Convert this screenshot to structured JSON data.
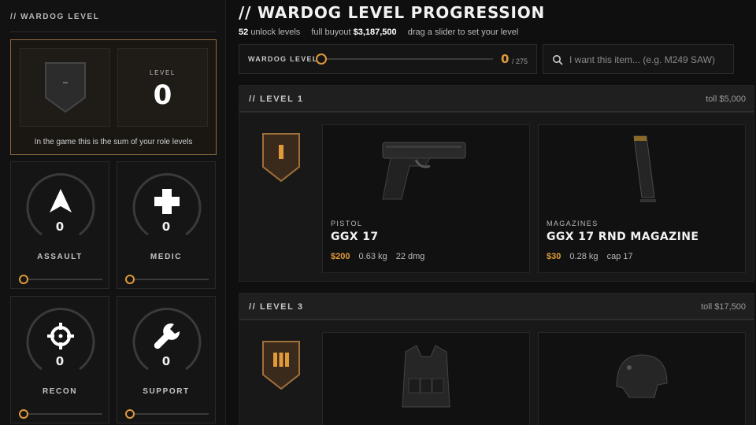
{
  "sidebar": {
    "title": "// WARDOG LEVEL",
    "level_caption": "LEVEL",
    "level_value": "0",
    "level_note": "In the game this is the sum of your role levels",
    "roles": [
      {
        "name": "ASSAULT",
        "value": "0",
        "icon": "assault-arrow-icon"
      },
      {
        "name": "MEDIC",
        "value": "0",
        "icon": "medic-cross-icon"
      },
      {
        "name": "RECON",
        "value": "0",
        "icon": "recon-crosshair-icon"
      },
      {
        "name": "SUPPORT",
        "value": "0",
        "icon": "support-wrench-icon"
      }
    ]
  },
  "header": {
    "title": "// WARDOG LEVEL PROGRESSION",
    "unlock_count": "52",
    "unlock_label": "unlock levels",
    "buyout_label": "full buyout",
    "buyout_value": "$3,187,500",
    "hint": "drag a slider to set your level"
  },
  "wardog_slider": {
    "label": "WARDOG LEVEL",
    "value": "0",
    "max": "/ 275",
    "fraction": 0
  },
  "search": {
    "placeholder": "I want this item... (e.g. M249 SAW)"
  },
  "levels": [
    {
      "title": "// LEVEL 1",
      "toll": "toll $5,000",
      "badge": "I",
      "items": [
        {
          "category": "PISTOL",
          "name": "GGX 17",
          "price": "$200",
          "weight": "0.63 kg",
          "stat": "22 dmg",
          "icon": "pistol-icon"
        },
        {
          "category": "MAGAZINES",
          "name": "GGX 17 RND MAGAZINE",
          "price": "$30",
          "weight": "0.28 kg",
          "stat": "cap 17",
          "icon": "magazine-icon"
        }
      ]
    },
    {
      "title": "// LEVEL 3",
      "toll": "toll $17,500",
      "badge": "III",
      "items": [
        {
          "icon": "tactical-vest-icon"
        },
        {
          "icon": "helmet-icon"
        }
      ]
    }
  ],
  "colors": {
    "accent": "#e09a3a",
    "background": "#0f0f0f",
    "panel": "#151515",
    "level_border": "#8e6a3e"
  }
}
